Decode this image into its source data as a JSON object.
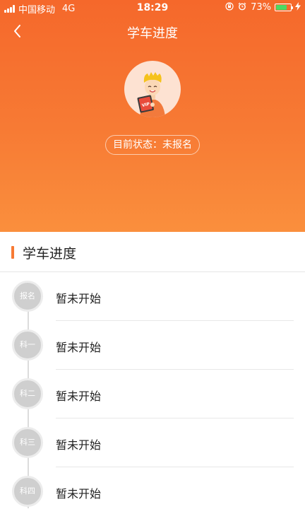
{
  "status_bar": {
    "carrier": "中国移动",
    "network": "4G",
    "time": "18:29",
    "battery": "73%",
    "battery_level": 0.73,
    "icons": [
      "signal-icon",
      "lock-rotation-icon",
      "alarm-icon",
      "battery-icon",
      "charging-icon"
    ]
  },
  "nav": {
    "title": "学车进度",
    "back_icon": "chevron-left-icon"
  },
  "avatar": {
    "icon": "vip-avatar-illustration",
    "badge_text": "VIP"
  },
  "status_pill": {
    "text": "目前状态：未报名"
  },
  "section": {
    "title": "学车进度"
  },
  "steps": [
    {
      "node": "报名",
      "text": "暂未开始"
    },
    {
      "node": "科一",
      "text": "暂未开始"
    },
    {
      "node": "科二",
      "text": "暂未开始"
    },
    {
      "node": "科三",
      "text": "暂未开始"
    },
    {
      "node": "科四",
      "text": "暂未开始"
    }
  ],
  "colors": {
    "primary": "#f77a34",
    "gradient_top": "#f5682b",
    "gradient_bottom": "#fa8f3d",
    "node_gray": "#cfcfcf",
    "battery_green": "#4cd964"
  }
}
